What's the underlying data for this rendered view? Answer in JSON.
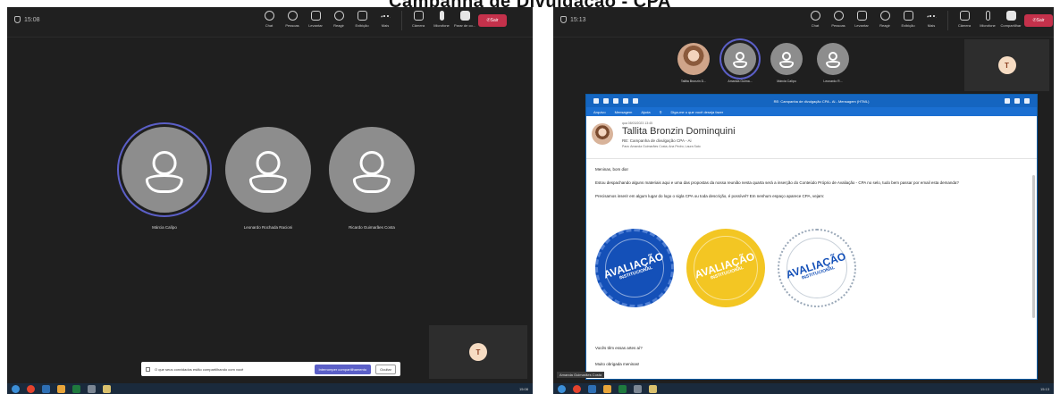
{
  "page_title": "Campanha de Divulgação - CPA",
  "left": {
    "timer": "15:08",
    "toolbar": [
      "Chat",
      "Pessoas",
      "Levantar",
      "Reagir",
      "Exibição",
      "Mais",
      "Câmera",
      "Microfone",
      "Parar de co..."
    ],
    "leave_label": "Sair",
    "participants": [
      {
        "name": "Márcia Calípo"
      },
      {
        "name": "Leonardo Rochada Racioni"
      },
      {
        "name": "Ricardo Guimarães Costa"
      }
    ],
    "self_initial": "T",
    "share_notice": "O que seus convidados estão compartilhando com você",
    "share_button": "Interromper compartilhamento",
    "share_button2": "Ocultar",
    "tray": "15:08"
  },
  "right": {
    "timer": "15:13",
    "toolbar": [
      "Chat",
      "Pessoas",
      "Levantar",
      "Reagir",
      "Exibição",
      "Mais",
      "Câmera",
      "Microfone",
      "Compartilhar"
    ],
    "leave_label": "Sair",
    "participants": [
      {
        "name": "Tallita Bronzin D..."
      },
      {
        "name": "Amanda Guima..."
      },
      {
        "name": "Márcia Calípo"
      },
      {
        "name": "Leonardo R..."
      }
    ],
    "self_initial": "T",
    "email": {
      "window_title": "RE: Campanha de divulgação CPA - Ai - Mensagem (HTML)",
      "ribbon": [
        "Arquivo",
        "Mensagem",
        "Ajuda",
        "Diga-me o que você deseja fazer"
      ],
      "date": "qua 08/03/2023 13:45",
      "sender": "Tallita Bronzin Dominquini",
      "subject": "RE: Campanha de divulgação CPA - Ai",
      "recipients": "Para: Amanda Guimarães Costa; Ana Pedro; Laura Sato",
      "greeting": "Meninas, bom dia!",
      "paragraph1": "Estou despachando alguns materiais aqui e uma das propostas da nossa reunião nesta quarta será a inserção do Conteúdo Próprio de Avaliação - CPA no selo, tudo bem passar por email esta demanda?",
      "paragraph2": "Precisamos inserir em algum lugar do logo o sigla CPA ou toda descrição, é possível? Em nenhum espaço aparece CPA, vejam:",
      "stamp_word": "AVALIAÇÃO",
      "stamp_sub": "INSTITUCIONAL",
      "line_after1": "Vocês têm essas artes aí?",
      "line_after2": "Muito obrigada meninas!"
    },
    "presenter_tab": "Amanda Guimarães Costa",
    "tray": "15:13"
  }
}
